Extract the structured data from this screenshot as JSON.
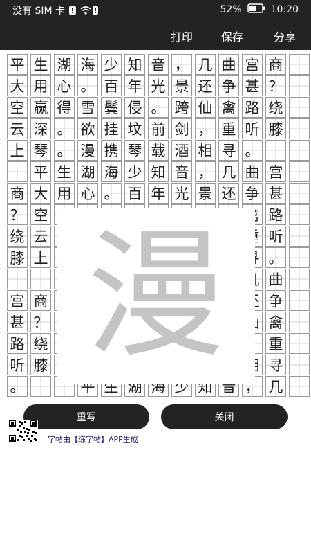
{
  "status_bar": {
    "carrier": "没有 SIM 卡",
    "battery": "52%",
    "time": "10:20"
  },
  "toolbar": {
    "print_label": "打印",
    "save_label": "保存",
    "share_label": "分享"
  },
  "grid": {
    "rows": [
      [
        "平",
        "生",
        "湖",
        "海",
        "少",
        "知",
        "音",
        "，",
        "几",
        "曲",
        "宫",
        "商",
        ""
      ],
      [
        "大",
        "用",
        "心",
        "。",
        "百",
        "年",
        "光",
        "景",
        "还",
        "争",
        "甚",
        "？",
        ""
      ],
      [
        "空",
        "赢",
        "得",
        "雪",
        "鬓",
        "侵",
        "。",
        "跨",
        "仙",
        "禽",
        "路",
        "绕",
        ""
      ],
      [
        "云",
        "深",
        "。",
        "欲",
        "挂",
        "坟",
        "前",
        "剑",
        "，",
        "重",
        "听",
        "膝",
        ""
      ],
      [
        "上",
        "琴",
        "。",
        "漫",
        "携",
        "琴",
        "载",
        "酒",
        "相",
        "寻",
        "。",
        "",
        ""
      ],
      [
        "",
        "平",
        "生",
        "湖",
        "海",
        "少",
        "知",
        "音",
        "，",
        "几",
        "曲",
        "宫",
        ""
      ],
      [
        "商",
        "大",
        "用",
        "心",
        "。",
        "百",
        "年",
        "光",
        "景",
        "还",
        "争",
        "甚",
        ""
      ],
      [
        "？",
        "空",
        "",
        "",
        "",
        "",
        "",
        "",
        "",
        "",
        "禽",
        "路",
        ""
      ],
      [
        "绕",
        "云",
        "",
        "",
        "",
        "",
        "",
        "",
        "",
        "",
        "重",
        "听",
        ""
      ],
      [
        "膝",
        "上",
        "",
        "",
        "",
        "",
        "",
        "",
        "",
        "",
        "寻",
        "。",
        ""
      ],
      [
        "",
        "",
        "",
        "",
        "",
        "",
        "",
        "",
        "",
        "",
        "几",
        "曲",
        ""
      ],
      [
        "宫",
        "商",
        "",
        "",
        "",
        "",
        "",
        "",
        "",
        "",
        "还",
        "争",
        ""
      ],
      [
        "甚",
        "？",
        "",
        "",
        "",
        "",
        "",
        "",
        "",
        "",
        "仙",
        "禽",
        ""
      ],
      [
        "路",
        "绕",
        "",
        "",
        "",
        "",
        "",
        "",
        "",
        "",
        "，",
        "重",
        ""
      ],
      [
        "听",
        "膝",
        "",
        "",
        "",
        "",
        "",
        "",
        "",
        "",
        "相",
        "寻",
        ""
      ],
      [
        "。",
        "",
        "",
        "平",
        "生",
        "湖",
        "海",
        "少",
        "知",
        "音",
        "，",
        "几",
        ""
      ]
    ]
  },
  "preview_char": "漫",
  "buttons": {
    "rewrite": "重写",
    "close": "关闭"
  },
  "footer_text": "字帖由【练字帖】APP生成"
}
